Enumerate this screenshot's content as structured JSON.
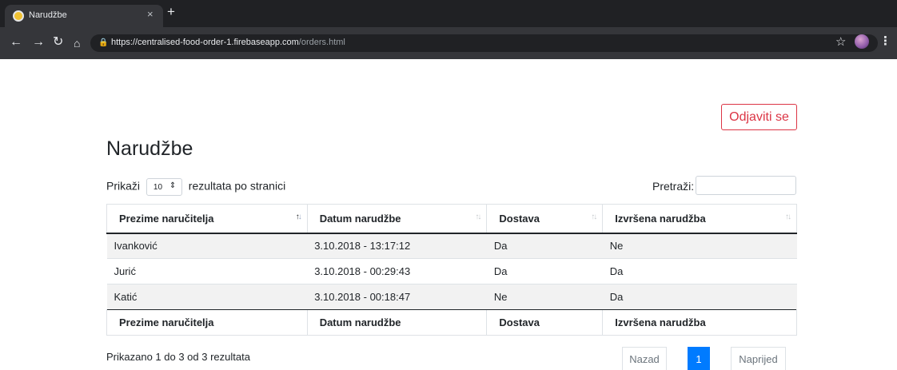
{
  "browser": {
    "tab_title": "Narudžbe",
    "tab_close": "×",
    "new_tab": "+",
    "url_host": "https://centralised-food-order-1.firebaseapp.com",
    "url_path": "/orders.html"
  },
  "page": {
    "logout_label": "Odjaviti se",
    "title": "Narudžbe"
  },
  "length": {
    "prefix": "Prikaži",
    "value": "10",
    "suffix": "rezultata po stranici"
  },
  "search": {
    "label": "Pretraži:",
    "value": ""
  },
  "table": {
    "headers": [
      "Prezime naručitelja",
      "Datum narudžbe",
      "Dostava",
      "Izvršena narudžba"
    ],
    "rows": [
      [
        "Ivanković",
        "3.10.2018 - 13:17:12",
        "Da",
        "Ne"
      ],
      [
        "Jurić",
        "3.10.2018 - 00:29:43",
        "Da",
        "Da"
      ],
      [
        "Katić",
        "3.10.2018 - 00:18:47",
        "Ne",
        "Da"
      ]
    ],
    "sorted_column": "Prezime naručitelja",
    "sort_direction": "ascending"
  },
  "footer": {
    "info": "Prikazano 1 do 3 od 3 rezultata",
    "prev": "Nazad",
    "current_page": "1",
    "next": "Naprijed"
  },
  "colors": {
    "accent": "#007bff",
    "logout": "#dc3545"
  }
}
